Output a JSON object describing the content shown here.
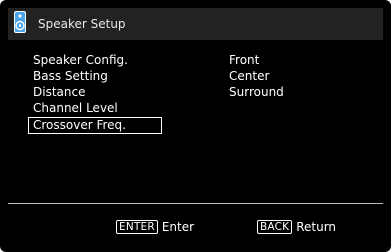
{
  "header": {
    "title": "Speaker Setup",
    "icon": "speaker-icon",
    "accent_color": "#4aa3e8"
  },
  "menu": {
    "items": [
      {
        "label": "Speaker Config."
      },
      {
        "label": "Bass Setting"
      },
      {
        "label": "Distance"
      },
      {
        "label": "Channel Level"
      },
      {
        "label": "Crossover Freq."
      }
    ],
    "selected_index": 4
  },
  "submenu": {
    "items": [
      {
        "label": "Front"
      },
      {
        "label": "Center"
      },
      {
        "label": "Surround"
      }
    ]
  },
  "footer": {
    "enter_key": "ENTER",
    "enter_label": "Enter",
    "back_key": "BACK",
    "back_label": "Return"
  }
}
